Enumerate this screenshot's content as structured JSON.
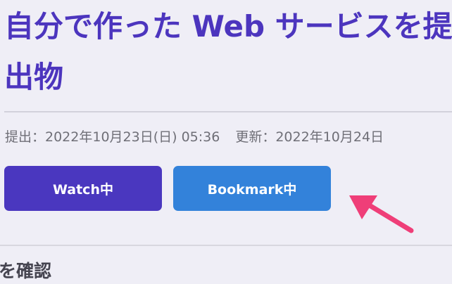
{
  "page": {
    "title": "自分で作った Web サービスを提出物",
    "submitted_label": "提出：2022年10月23日(日) 05:36",
    "updated_label": "更新：2022年10月24日",
    "section_title": "を確認"
  },
  "actions": {
    "watch_label": "Watch中",
    "bookmark_label": "Bookmark中"
  },
  "colors": {
    "title": "#4c35be",
    "watch_button": "#4a37bf",
    "bookmark_button": "#3382da",
    "annotation_arrow": "#ef3e78"
  },
  "annotation": {
    "icon": "pink-arrow-icon"
  }
}
